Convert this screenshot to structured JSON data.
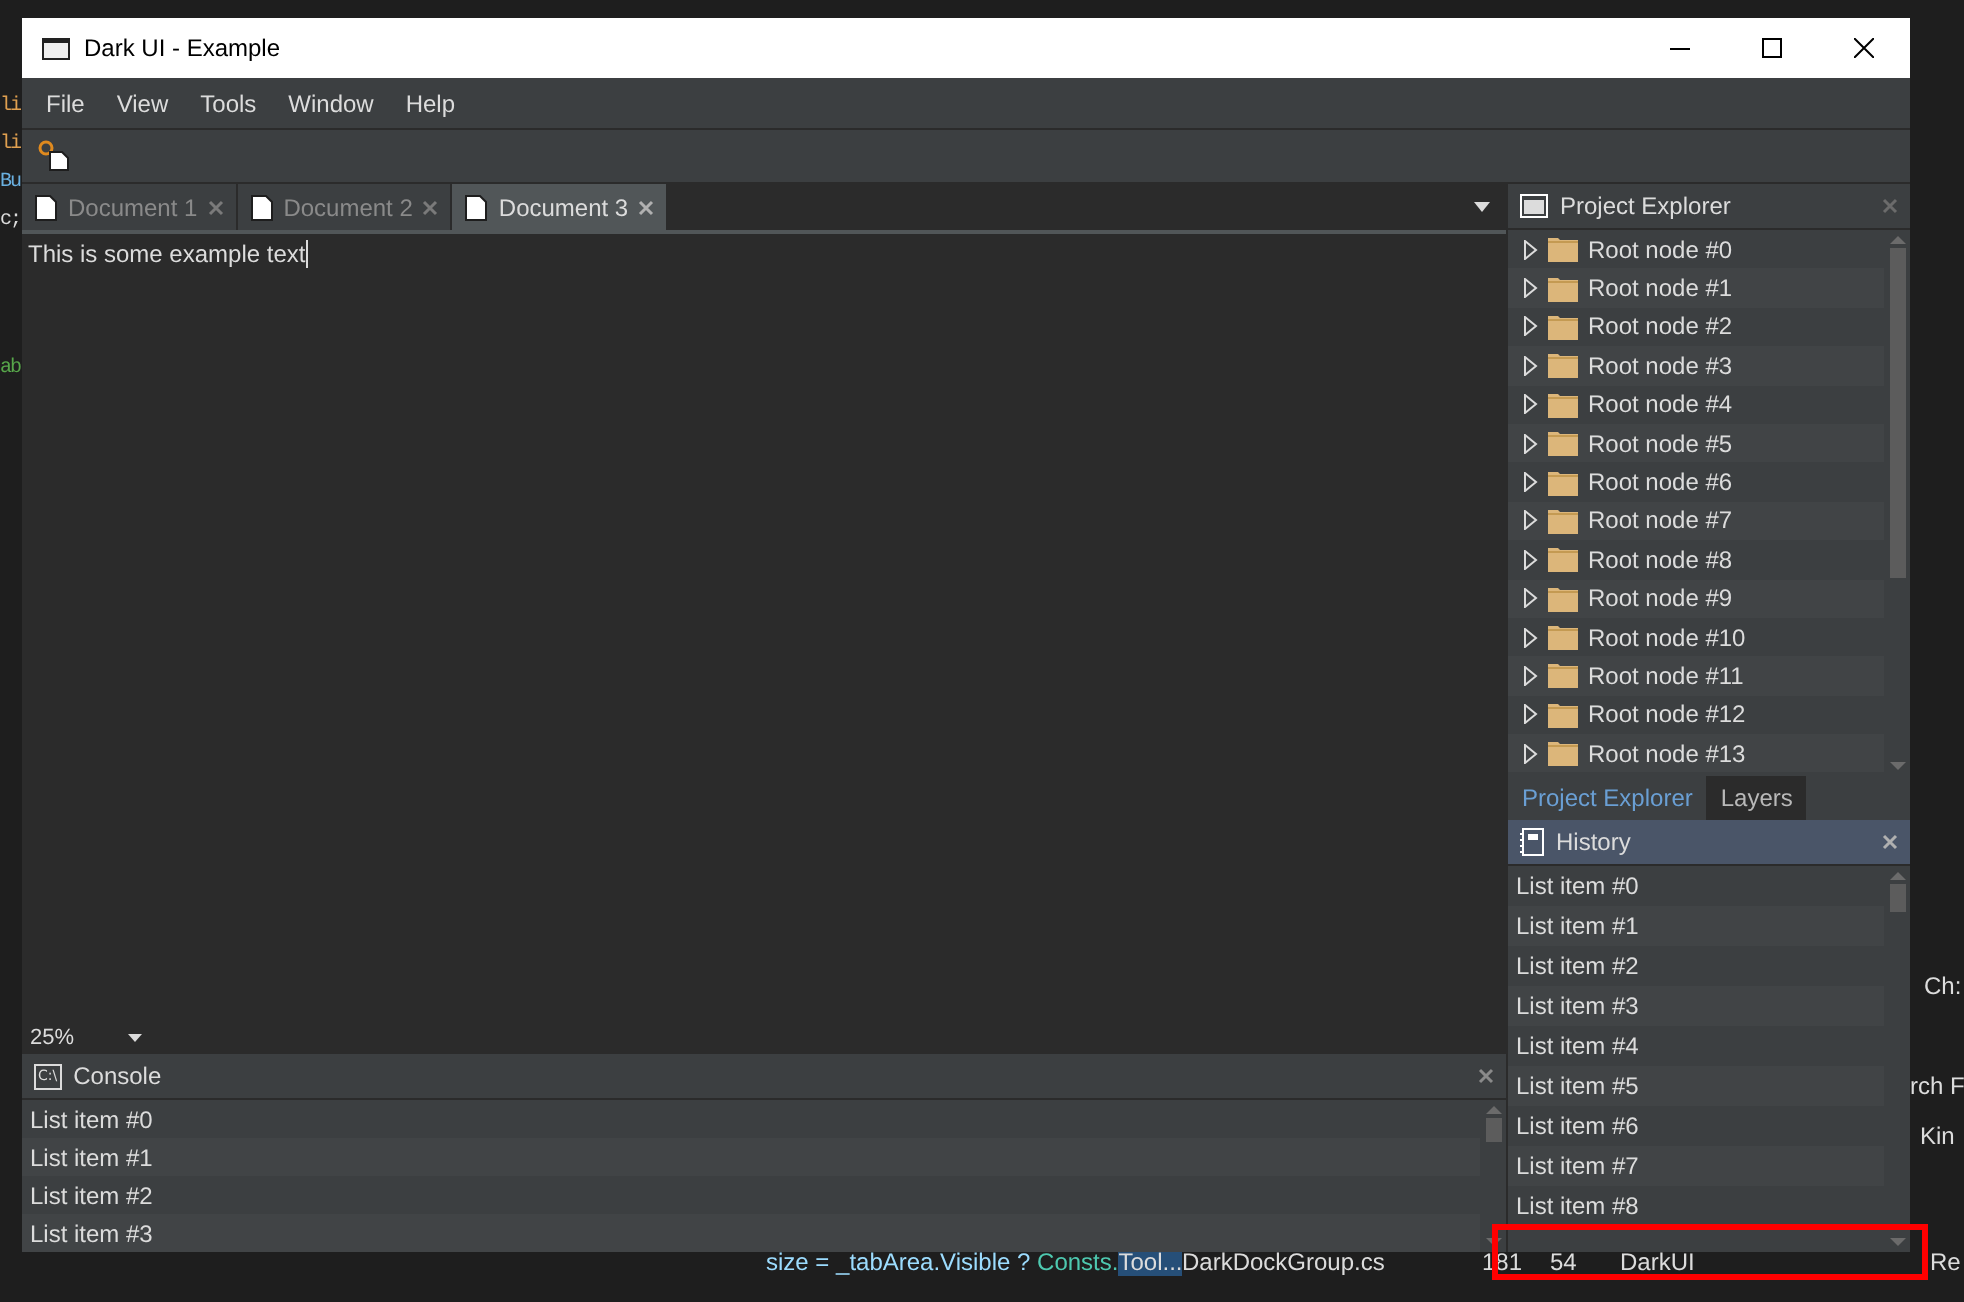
{
  "backdrop": {
    "left_fragments": [
      {
        "text": "li",
        "kind": "keyword"
      },
      {
        "text": "li",
        "kind": "keyword"
      },
      {
        "text": "Bu",
        "kind": "type"
      },
      {
        "text": "c;",
        "kind": "plain"
      },
      {
        "text": "ab",
        "kind": "comment"
      }
    ],
    "right_fragments": [
      "Ch:",
      "rch F",
      "Kin"
    ],
    "rows": [
      {
        "code": "size = _tabArea.Visible ?",
        "code_class": "Consts.",
        "code_member": "Tool...",
        "file": "DarkDockGroup.cs",
        "line": "181",
        "column": "54",
        "project": "DarkUI",
        "column_6": "Re"
      }
    ]
  },
  "highlight_box": true,
  "window": {
    "title": "Dark UI - Example"
  },
  "menu": [
    "File",
    "View",
    "Tools",
    "Window",
    "Help"
  ],
  "document_tabs": [
    {
      "label": "Document 1",
      "selected": false
    },
    {
      "label": "Document 2",
      "selected": false
    },
    {
      "label": "Document 3",
      "selected": true
    }
  ],
  "editor": {
    "text": "This is some example text"
  },
  "zoom": {
    "value": "25%"
  },
  "console": {
    "title": "Console",
    "icon_text": "C:\\",
    "active": false,
    "items": [
      "List item #0",
      "List item #1",
      "List item #2",
      "List item #3"
    ]
  },
  "project_explorer": {
    "title": "Project Explorer",
    "active": false,
    "nodes": [
      {
        "label": "Root node #0",
        "expanded": false
      },
      {
        "label": "Root node #1",
        "expanded": false
      },
      {
        "label": "Root node #2",
        "expanded": false
      },
      {
        "label": "Root node #3",
        "expanded": false
      },
      {
        "label": "Root node #4",
        "expanded": false
      },
      {
        "label": "Root node #5",
        "expanded": false
      },
      {
        "label": "Root node #6",
        "expanded": false
      },
      {
        "label": "Root node #7",
        "expanded": false
      },
      {
        "label": "Root node #8",
        "expanded": false
      },
      {
        "label": "Root node #9",
        "expanded": false
      },
      {
        "label": "Root node #10",
        "expanded": false
      },
      {
        "label": "Root node #11",
        "expanded": false
      },
      {
        "label": "Root node #12",
        "expanded": false
      },
      {
        "label": "Root node #13",
        "expanded": false
      }
    ]
  },
  "right_tabs": [
    {
      "label": "Project Explorer",
      "selected": true
    },
    {
      "label": "Layers",
      "selected": false
    }
  ],
  "history": {
    "title": "History",
    "active": true,
    "items": [
      "List item #0",
      "List item #1",
      "List item #2",
      "List item #3",
      "List item #4",
      "List item #5",
      "List item #6",
      "List item #7",
      "List item #8"
    ]
  }
}
